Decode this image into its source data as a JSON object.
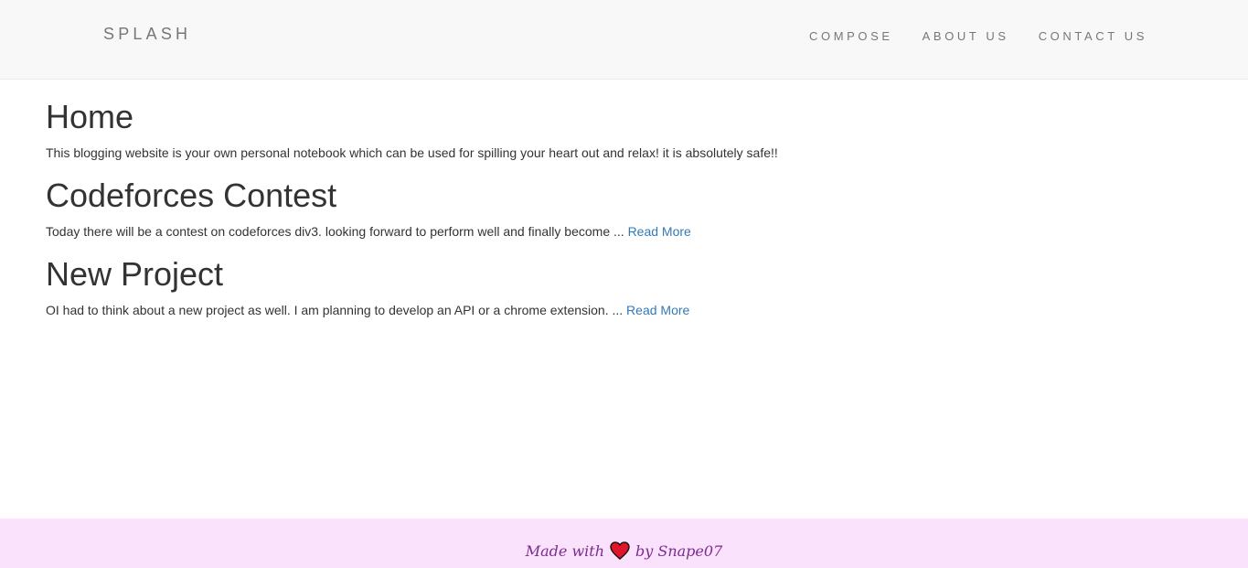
{
  "navbar": {
    "brand": "SPLASH",
    "links": [
      "COMPOSE",
      "ABOUT US",
      "CONTACT US"
    ]
  },
  "home": {
    "title": "Home",
    "text": "This blogging website is your own personal notebook which can be used for spilling your heart out and relax! it is absolutely safe!!"
  },
  "posts": [
    {
      "title": "Codeforces Contest",
      "excerpt": "Today there will be a contest on codeforces div3. looking forward to perform well and finally become ... ",
      "link_label": "Read More"
    },
    {
      "title": "New Project",
      "excerpt": "OI had to think about a new project as well. I am planning to develop an API or a chrome extension. ... ",
      "link_label": "Read More"
    }
  ],
  "footer": {
    "made_with": "Made with",
    "heart_icon": "heart-icon",
    "by": "by Snape07"
  },
  "colors": {
    "navbar_bg": "#f8f8f8",
    "footer_bg": "#fae1fc",
    "link": "#337ab7",
    "heart": "#e0152a"
  }
}
